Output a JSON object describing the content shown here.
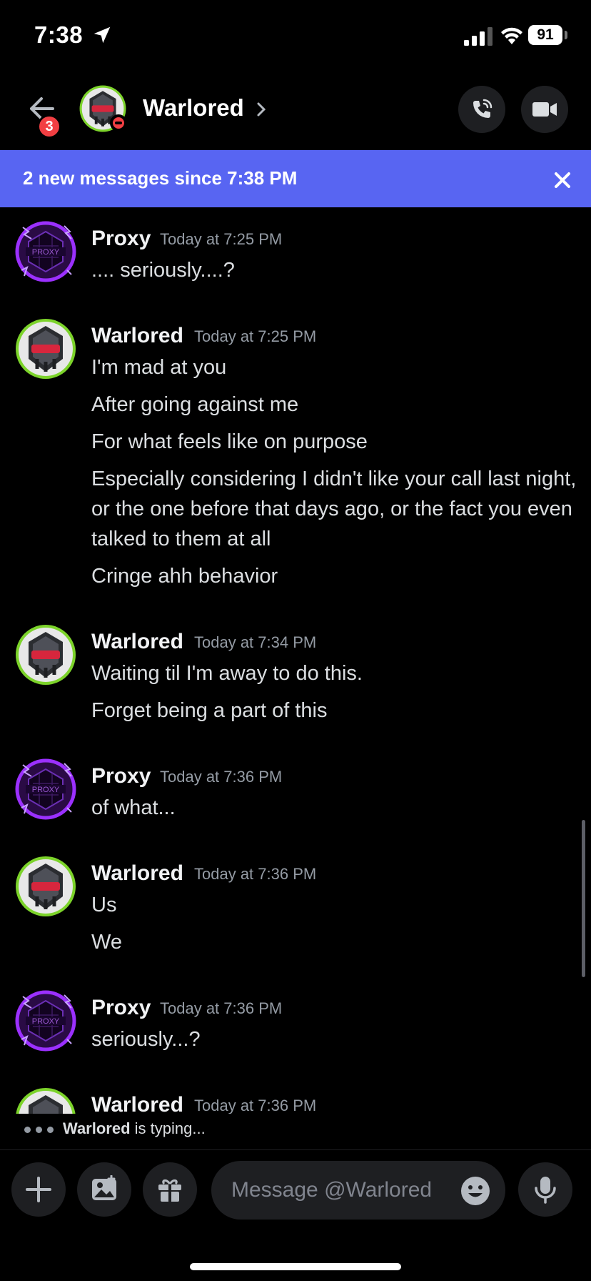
{
  "status_bar": {
    "time": "7:38",
    "battery": "91"
  },
  "header": {
    "title": "Warlored",
    "back_badge": "3"
  },
  "banner": {
    "text": "2 new messages since 7:38 PM"
  },
  "messages": [
    {
      "author": "Proxy",
      "time": "Today at 7:25 PM",
      "lines": [
        ".... seriously....?"
      ]
    },
    {
      "author": "Warlored",
      "time": "Today at 7:25 PM",
      "lines": [
        "I'm mad at you",
        "After going against me",
        "For what feels like on purpose",
        "Especially considering I didn't like your call last night, or the one before that days ago, or the fact you even talked to them at all",
        "Cringe ahh behavior"
      ]
    },
    {
      "author": "Warlored",
      "time": "Today at 7:34 PM",
      "lines": [
        "Waiting til I'm away to do this.",
        "Forget being a part of this"
      ]
    },
    {
      "author": "Proxy",
      "time": "Today at 7:36 PM",
      "lines": [
        "of what..."
      ]
    },
    {
      "author": "Warlored",
      "time": "Today at 7:36 PM",
      "lines": [
        "Us",
        "We"
      ]
    },
    {
      "author": "Proxy",
      "time": "Today at 7:36 PM",
      "lines": [
        "seriously...?"
      ]
    },
    {
      "author": "Warlored",
      "time": "Today at 7:36 PM",
      "lines": []
    }
  ],
  "typing": {
    "user": "Warlored",
    "suffix": " is typing..."
  },
  "composer": {
    "placeholder": "Message @Warlored"
  },
  "colors": {
    "accent": "#5865f2",
    "background": "#000000",
    "dnd": "#f23f43",
    "proxy_ring": "#9b30ff",
    "warlored_ring": "#7cd32a"
  }
}
